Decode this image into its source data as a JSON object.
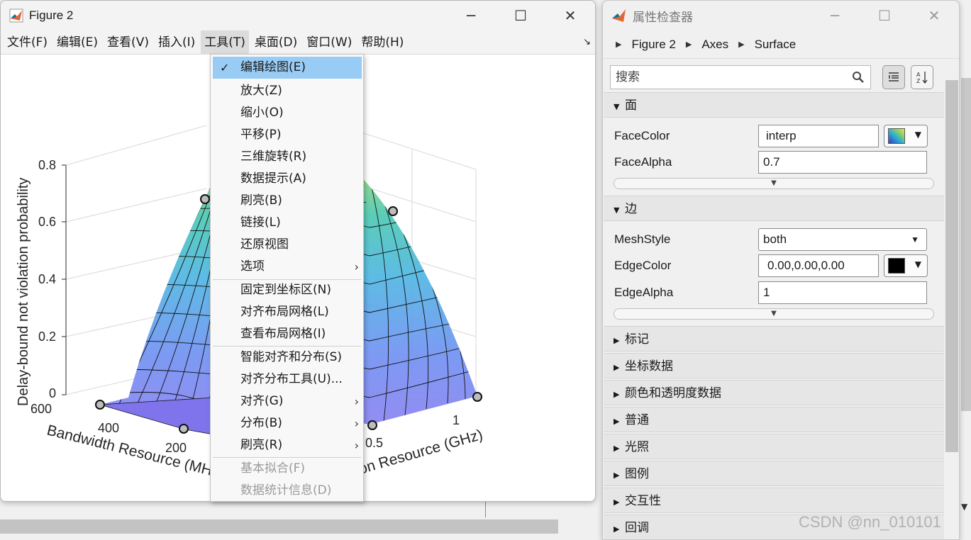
{
  "figure_window": {
    "title": "Figure 2",
    "menubar": [
      "文件(F)",
      "编辑(E)",
      "查看(V)",
      "插入(I)",
      "工具(T)",
      "桌面(D)",
      "窗口(W)",
      "帮助(H)"
    ]
  },
  "tools_menu": {
    "items": [
      {
        "label": "编辑绘图(E)",
        "checked": true
      },
      {
        "label": "放大(Z)"
      },
      {
        "label": "缩小(O)"
      },
      {
        "label": "平移(P)"
      },
      {
        "label": "三维旋转(R)"
      },
      {
        "label": "数据提示(A)"
      },
      {
        "label": "刷亮(B)"
      },
      {
        "label": "链接(L)"
      },
      {
        "label": "还原视图"
      },
      {
        "label": "选项"
      },
      {
        "label": "固定到坐标区(N)"
      },
      {
        "label": "对齐布局网格(L)"
      },
      {
        "label": "查看布局网格(I)"
      },
      {
        "label": "智能对齐和分布(S)"
      },
      {
        "label": "对齐分布工具(U)..."
      },
      {
        "label": "对齐(G)"
      },
      {
        "label": "分布(B)"
      },
      {
        "label": "刷亮(R)"
      },
      {
        "label": "基本拟合(F)",
        "disabled": true
      },
      {
        "label": "数据统计信息(D)",
        "disabled": true
      }
    ]
  },
  "plot": {
    "zlabel": "Delay-bound not violation probability",
    "xlabel": "Bandwidth Resource (MHz)",
    "ylabel": "Computation Resource (GHz)",
    "xlabel_visible": "Bandwidth Resource (MH",
    "ylabel_visible": "on Resource (GHz)",
    "z_ticks": [
      "0",
      "0.2",
      "0.4",
      "0.6",
      "0.8"
    ],
    "x_ticks": [
      "600",
      "400",
      "200"
    ],
    "y_ticks": [
      "0.5",
      "1"
    ]
  },
  "chart_data": {
    "type": "surface",
    "title": "",
    "xlabel": "Bandwidth Resource (MHz)",
    "ylabel": "Computation Resource (GHz)",
    "zlabel": "Delay-bound not violation probability",
    "zlim": [
      0,
      0.8
    ],
    "x_ticks": [
      600,
      400,
      200
    ],
    "y_ticks": [
      0.5,
      1
    ],
    "z_ticks": [
      0,
      0.2,
      0.4,
      0.6,
      0.8
    ],
    "colormap": "parula",
    "face_alpha": 0.7,
    "edge_color": "#000000"
  },
  "inspector": {
    "title": "属性检查器",
    "breadcrumbs": [
      "Figure 2",
      "Axes",
      "Surface"
    ],
    "search_placeholder": "搜索",
    "sections": {
      "face": "面",
      "edge": "边",
      "collapsed": [
        "标记",
        "坐标数据",
        "颜色和透明度数据",
        "普通",
        "光照",
        "图例",
        "交互性",
        "回调"
      ]
    },
    "props": {
      "face_color_label": "FaceColor",
      "face_color_value": "interp",
      "face_alpha_label": "FaceAlpha",
      "face_alpha_value": "0.7",
      "mesh_style_label": "MeshStyle",
      "mesh_style_value": "both",
      "edge_color_label": "EdgeColor",
      "edge_color_value": "0.00,0.00,0.00",
      "edge_alpha_label": "EdgeAlpha",
      "edge_alpha_value": "1"
    }
  },
  "watermark": "CSDN @nn_010101",
  "colors": {
    "menu_highlight": "#99ccf5",
    "matlab_orange": "#e16737",
    "matlab_blue": "#0076a8"
  }
}
